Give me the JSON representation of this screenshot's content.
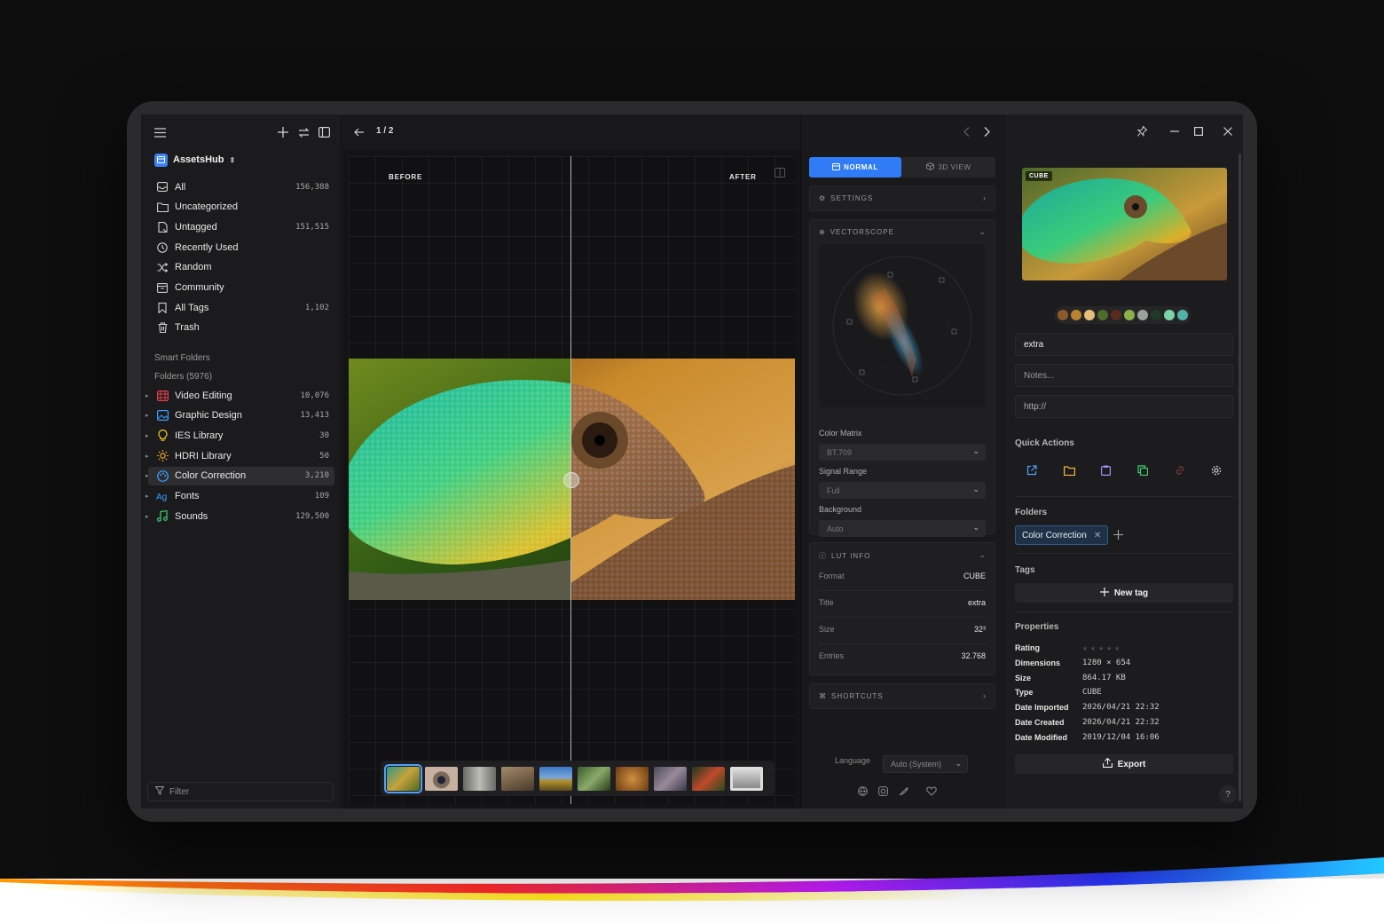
{
  "colors": {
    "accent": "#2f7cf6",
    "window_bg": "#1a1a1c"
  },
  "sidebar": {
    "brand": "AssetsHub",
    "items": [
      {
        "label": "All",
        "count": "156,388",
        "icon": "inbox-icon"
      },
      {
        "label": "Uncategorized",
        "count": "",
        "icon": "folder-icon"
      },
      {
        "label": "Untagged",
        "count": "151,515",
        "icon": "untagged-icon"
      },
      {
        "label": "Recently Used",
        "count": "",
        "icon": "clock-icon"
      },
      {
        "label": "Random",
        "count": "",
        "icon": "shuffle-icon"
      },
      {
        "label": "Community",
        "count": "",
        "icon": "community-icon"
      },
      {
        "label": "All Tags",
        "count": "1,102",
        "icon": "bookmark-icon"
      },
      {
        "label": "Trash",
        "count": "",
        "icon": "trash-icon"
      }
    ],
    "smart_folders_label": "Smart Folders",
    "folders_label": "Folders (5976)",
    "folders": [
      {
        "label": "Video Editing",
        "count": "10,076",
        "icon": "video-icon",
        "color": "#e0404a"
      },
      {
        "label": "Graphic Design",
        "count": "13,413",
        "icon": "image-icon",
        "color": "#3aa0ff"
      },
      {
        "label": "IES Library",
        "count": "30",
        "icon": "bulb-icon",
        "color": "#f3c623"
      },
      {
        "label": "HDRI Library",
        "count": "50",
        "icon": "sun-icon",
        "color": "#f5a623"
      },
      {
        "label": "Color Correction",
        "count": "3,210",
        "icon": "palette-icon",
        "color": "#3aa0ff"
      },
      {
        "label": "Fonts",
        "count": "109",
        "icon": "font-icon",
        "color": "#3aa0ff"
      },
      {
        "label": "Sounds",
        "count": "129,500",
        "icon": "music-icon",
        "color": "#3ccf6e"
      }
    ],
    "filter_placeholder": "Filter"
  },
  "viewer": {
    "pager": "1 / 2",
    "before_label": "BEFORE",
    "after_label": "AFTER"
  },
  "inspector": {
    "normal_label": "NORMAL",
    "view3d_label": "3D VIEW",
    "settings_label": "SETTINGS",
    "vectorscope_label": "VECTORSCOPE",
    "color_matrix_label": "Color Matrix",
    "color_matrix_value": "BT.709",
    "signal_range_label": "Signal Range",
    "signal_range_value": "Full",
    "background_label": "Background",
    "background_value": "Auto",
    "lut_info_label": "LUT INFO",
    "lut": [
      {
        "key": "Format",
        "value": "CUBE"
      },
      {
        "key": "Title",
        "value": "extra"
      },
      {
        "key": "Size",
        "value": "32³"
      },
      {
        "key": "Entries",
        "value": "32.768"
      }
    ],
    "shortcuts_label": "SHORTCUTS",
    "language_label": "Language",
    "language_value": "Auto (System)"
  },
  "details": {
    "badge": "CUBE",
    "swatches": [
      "#8a5a2b",
      "#b8822f",
      "#e3c07a",
      "#4f6b2a",
      "#5a2a1c",
      "#8ab04a",
      "#9aa29a",
      "#1f3a26",
      "#7cd3a8",
      "#4fb3a8"
    ],
    "name_value": "extra",
    "notes_placeholder": "Notes...",
    "url_placeholder": "http://",
    "quick_actions_label": "Quick Actions",
    "folders_label": "Folders",
    "folder_chip": "Color Correction",
    "tags_label": "Tags",
    "new_tag_label": "New tag",
    "properties_label": "Properties",
    "rating": 0,
    "properties": [
      {
        "key": "Rating",
        "value": ""
      },
      {
        "key": "Dimensions",
        "value": "1280 × 654"
      },
      {
        "key": "Size",
        "value": "864.17 KB"
      },
      {
        "key": "Type",
        "value": "CUBE"
      },
      {
        "key": "Date Imported",
        "value": "2026/04/21 22:32"
      },
      {
        "key": "Date Created",
        "value": "2026/04/21 22:32"
      },
      {
        "key": "Date Modified",
        "value": "2019/12/04 16:06"
      }
    ],
    "export_label": "Export",
    "help_label": "?"
  }
}
